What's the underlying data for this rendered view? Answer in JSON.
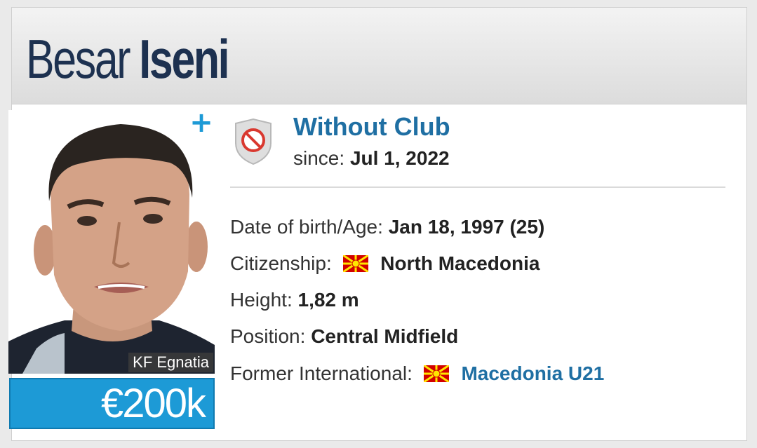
{
  "player": {
    "first_name": "Besar",
    "last_name": "Iseni"
  },
  "photo": {
    "club_tag": "KF Egnatia"
  },
  "market_value": "€200k",
  "club": {
    "name": "Without Club",
    "since_label": "since:",
    "since_value": "Jul 1, 2022"
  },
  "details": {
    "dob_label": "Date of birth/Age:",
    "dob_value": "Jan 18, 1997 (25)",
    "citizenship_label": "Citizenship:",
    "citizenship_value": "North Macedonia",
    "height_label": "Height:",
    "height_value": "1,82 m",
    "position_label": "Position:",
    "position_value": "Central Midfield",
    "former_int_label": "Former International:",
    "former_int_value": "Macedonia U21"
  },
  "icons": {
    "plus": "+",
    "flag": "north-macedonia-flag-icon",
    "crest": "no-club-crest-icon"
  },
  "colors": {
    "accent": "#1d9ad6",
    "link": "#1f6fa3",
    "name": "#1d3150"
  }
}
